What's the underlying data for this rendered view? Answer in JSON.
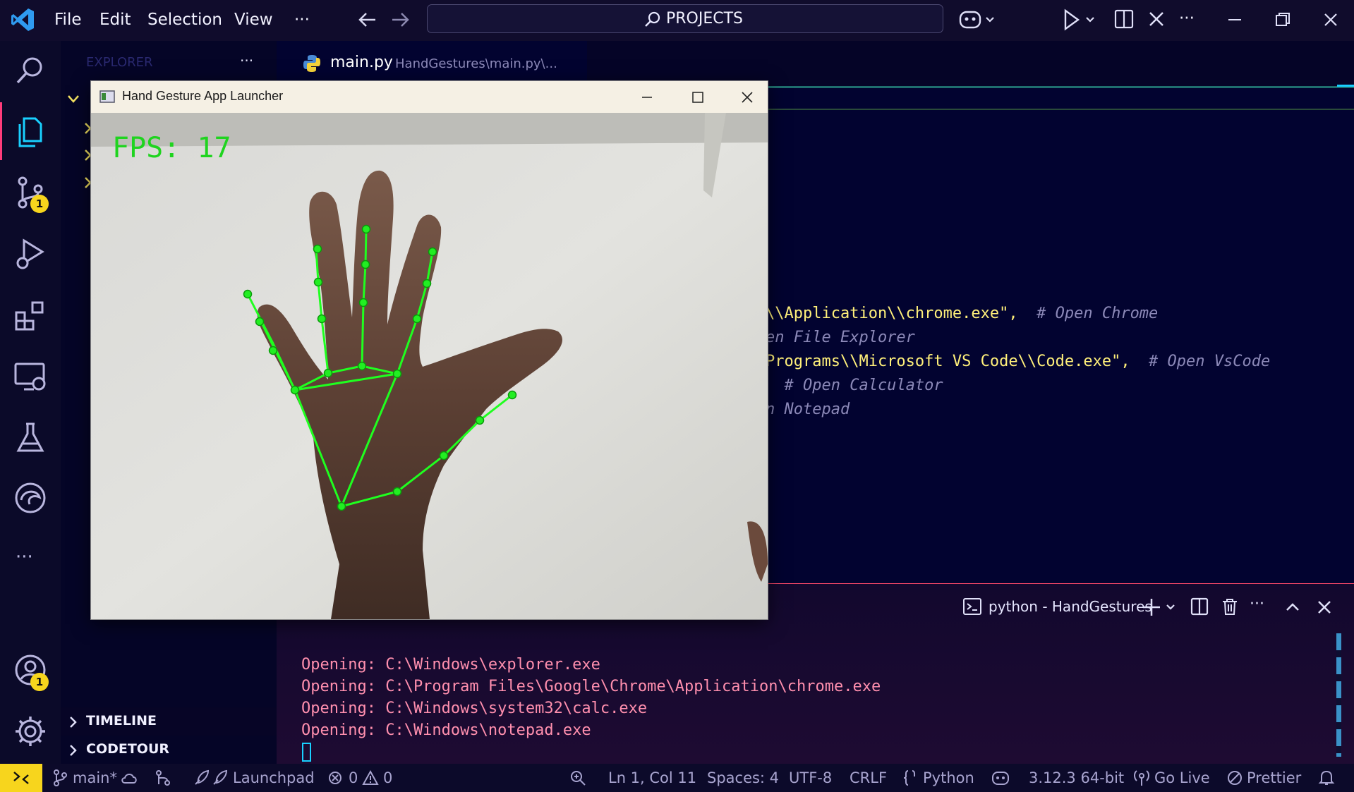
{
  "menu": {
    "file": "File",
    "edit": "Edit",
    "selection": "Selection",
    "view": "View",
    "more": "···"
  },
  "command_center": {
    "label": "PROJECTS"
  },
  "activity": {
    "source_control_badge": "1",
    "accounts_badge": "1"
  },
  "sidebar": {
    "title": "EXPLORER",
    "more": "···",
    "timeline": "TIMELINE",
    "codetour": "CODETOUR"
  },
  "tab": {
    "file": "main.py",
    "path": "HandGestures\\main.py\\..."
  },
  "code_lines": [
    {
      "str": "\\\\Application\\\\chrome.exe\",",
      "cmt": "  # Open Chrome"
    },
    {
      "str": "",
      "cmt": "en File Explorer"
    },
    {
      "str": "Programs\\\\Microsoft VS Code\\\\Code.exe\",",
      "cmt": "  # Open VsCode"
    },
    {
      "str": "",
      "cmt": "  # Open Calculator"
    },
    {
      "str": "",
      "cmt": "n Notepad"
    }
  ],
  "terminal": {
    "title": "python - HandGestures",
    "lines": [
      "Opening: C:\\Windows\\explorer.exe",
      "Opening: C:\\Program Files\\Google\\Chrome\\Application\\chrome.exe",
      "Opening: C:\\Windows\\system32\\calc.exe",
      "Opening: C:\\Windows\\notepad.exe"
    ]
  },
  "statusbar": {
    "branch": "main*",
    "launchpad": "Launchpad",
    "errors": "0",
    "warnings": "0",
    "position": "Ln 1, Col 11",
    "spaces": "Spaces: 4",
    "encoding": "UTF-8",
    "eol": "CRLF",
    "language": "Python",
    "interpreter": "3.12.3 64-bit",
    "golive": "Go Live",
    "prettier": "Prettier"
  },
  "app_window": {
    "title": "Hand Gesture App Launcher",
    "fps": "FPS: 17"
  },
  "colors": {
    "accent": "#f7d51d",
    "landmark": "#1fff1f",
    "terminal_text": "#ff8fae",
    "string": "#fff07a"
  }
}
